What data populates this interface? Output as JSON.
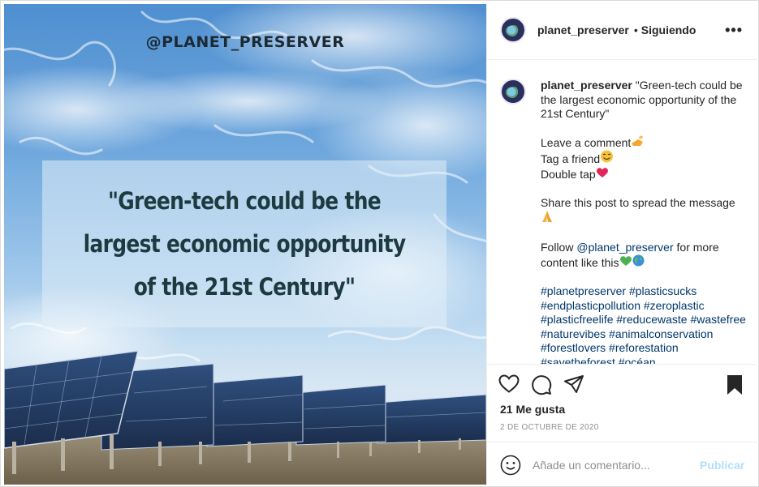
{
  "header": {
    "username": "planet_preserver",
    "separator": "•",
    "follow_status": "Siguiendo",
    "more_icon": "more-horizontal-icon",
    "more_label": "•••"
  },
  "image": {
    "handle": "@PLANET_PRESERVER",
    "quote": "\"Green-tech could be the\nlargest economic opportunity\nof the 21st Century\""
  },
  "caption": {
    "username": "planet_preserver",
    "text": "\"Green-tech could be the largest economic opportunity of the 21st Century\"",
    "leave_comment": "Leave a comment",
    "tag_friend": "Tag a friend",
    "double_tap": "Double tap",
    "share": "Share this post to spread the message",
    "follow_prefix": "Follow",
    "mention": "@planet_preserver",
    "follow_suffix": "for more content like this",
    "hashtags": [
      "#planetpreserver",
      "#plasticsucks",
      "#endplasticpollution",
      "#zeroplastic",
      "#plasticfreelife",
      "#reducewaste",
      "#wastefree",
      "#naturevibes",
      "#animalconservation",
      "#forestlovers",
      "#reforestation",
      "#savetheforest",
      "#océan"
    ]
  },
  "actions": {
    "icons": [
      "heart-icon",
      "comment-icon",
      "share-icon",
      "bookmark-icon"
    ]
  },
  "likes": "21 Me gusta",
  "date": "2 DE OCTUBRE DE 2020",
  "comment_box": {
    "placeholder": "Añade un comentario...",
    "publish_label": "Publicar"
  },
  "colors": {
    "link": "#00376b",
    "publish_disabled": "#b2dffc",
    "heart_emoji": "#e0245e",
    "green_heart_emoji": "#4caf50"
  }
}
